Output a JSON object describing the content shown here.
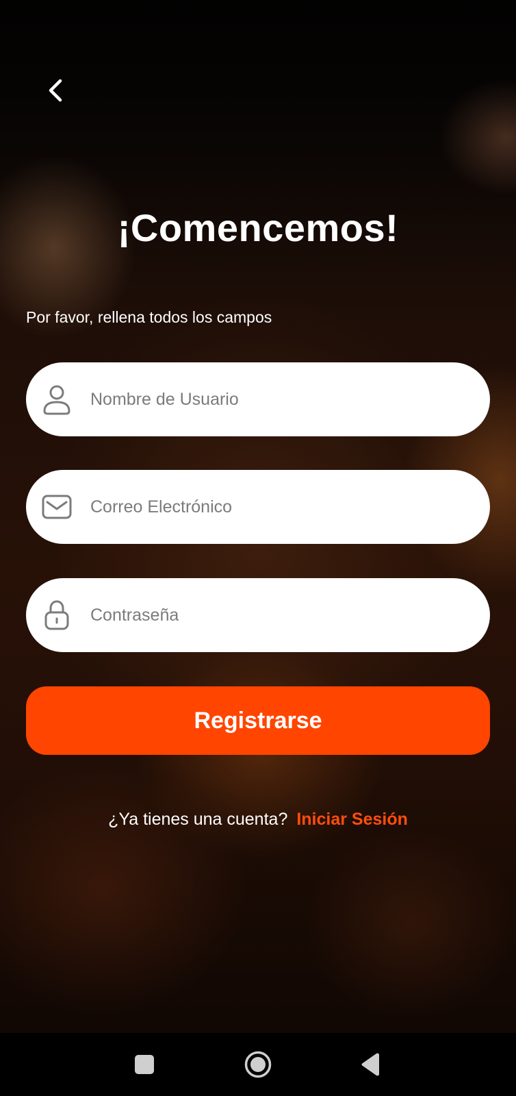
{
  "header": {
    "back_icon": "chevron-left-icon"
  },
  "main": {
    "title": "¡Comencemos!",
    "subtitle": "Por favor, rellena todos los campos"
  },
  "form": {
    "username": {
      "icon": "user-icon",
      "placeholder": "Nombre de Usuario",
      "value": ""
    },
    "email": {
      "icon": "mail-icon",
      "placeholder": "Correo Electrónico",
      "value": ""
    },
    "password": {
      "icon": "lock-icon",
      "placeholder": "Contraseña",
      "value": ""
    },
    "submit_label": "Registrarse"
  },
  "footer": {
    "prompt": "¿Ya tienes una cuenta?",
    "login_link": "Iniciar Sesión"
  },
  "system_nav": {
    "recents_icon": "square-icon",
    "home_icon": "circle-icon",
    "back_icon": "triangle-back-icon"
  },
  "colors": {
    "accent": "#ff4500",
    "link": "#ff4d0d",
    "field_bg": "#ffffff",
    "text_light": "#ffffff",
    "placeholder": "#7b7b7b"
  }
}
